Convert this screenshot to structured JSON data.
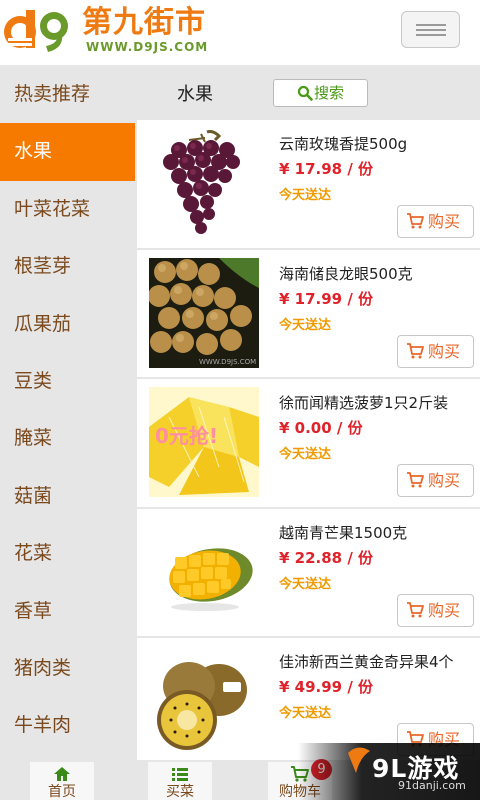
{
  "header": {
    "brand_name": "第九街市",
    "brand_url": "WWW.D9JS.COM",
    "logo_mark": "D9"
  },
  "sidebar": {
    "items": [
      {
        "label": "热卖推荐"
      },
      {
        "label": "水果",
        "active": true
      },
      {
        "label": "叶菜花菜"
      },
      {
        "label": "根茎芽"
      },
      {
        "label": "瓜果茄"
      },
      {
        "label": "豆类"
      },
      {
        "label": "腌菜"
      },
      {
        "label": "菇菌"
      },
      {
        "label": "花菜"
      },
      {
        "label": "香草"
      },
      {
        "label": "猪肉类"
      },
      {
        "label": "牛羊肉"
      }
    ]
  },
  "content": {
    "title": "水果",
    "search_label": "搜索",
    "products": [
      {
        "name": "云南玫瑰香提500g",
        "price": "¥ 17.98 / 份",
        "delivery": "今天送达",
        "buy_label": "购买",
        "image": "grapes"
      },
      {
        "name": "海南储良龙眼500克",
        "price": "¥ 17.99 / 份",
        "delivery": "今天送达",
        "buy_label": "购买",
        "image": "longan",
        "image_caption": "WWW.D9JS.COM"
      },
      {
        "name": "徐而闻精选菠萝1只2斤装",
        "price": "¥ 0.00 / 份",
        "delivery": "今天送达",
        "buy_label": "购买",
        "image": "pineapple",
        "image_caption": "0元抢!"
      },
      {
        "name": "越南青芒果1500克",
        "price": "¥ 22.88 / 份",
        "delivery": "今天送达",
        "buy_label": "购买",
        "image": "mango"
      },
      {
        "name": "佳沛新西兰黄金奇异果4个",
        "price": "¥ 49.99 / 份",
        "delivery": "今天送达",
        "buy_label": "购买",
        "image": "kiwi"
      }
    ]
  },
  "bottom_nav": {
    "items": [
      {
        "label": "首页",
        "icon": "home-icon"
      },
      {
        "label": "买菜",
        "icon": "list-icon"
      },
      {
        "label": "购物车",
        "icon": "cart-icon"
      }
    ],
    "cart_badge": "9"
  },
  "watermark": {
    "text": "9L游戏",
    "url": "91danji.com"
  },
  "colors": {
    "accent": "#f77a00",
    "price": "#e0222a",
    "delivery": "#f09a00",
    "brand_green": "#6a9a2b"
  }
}
